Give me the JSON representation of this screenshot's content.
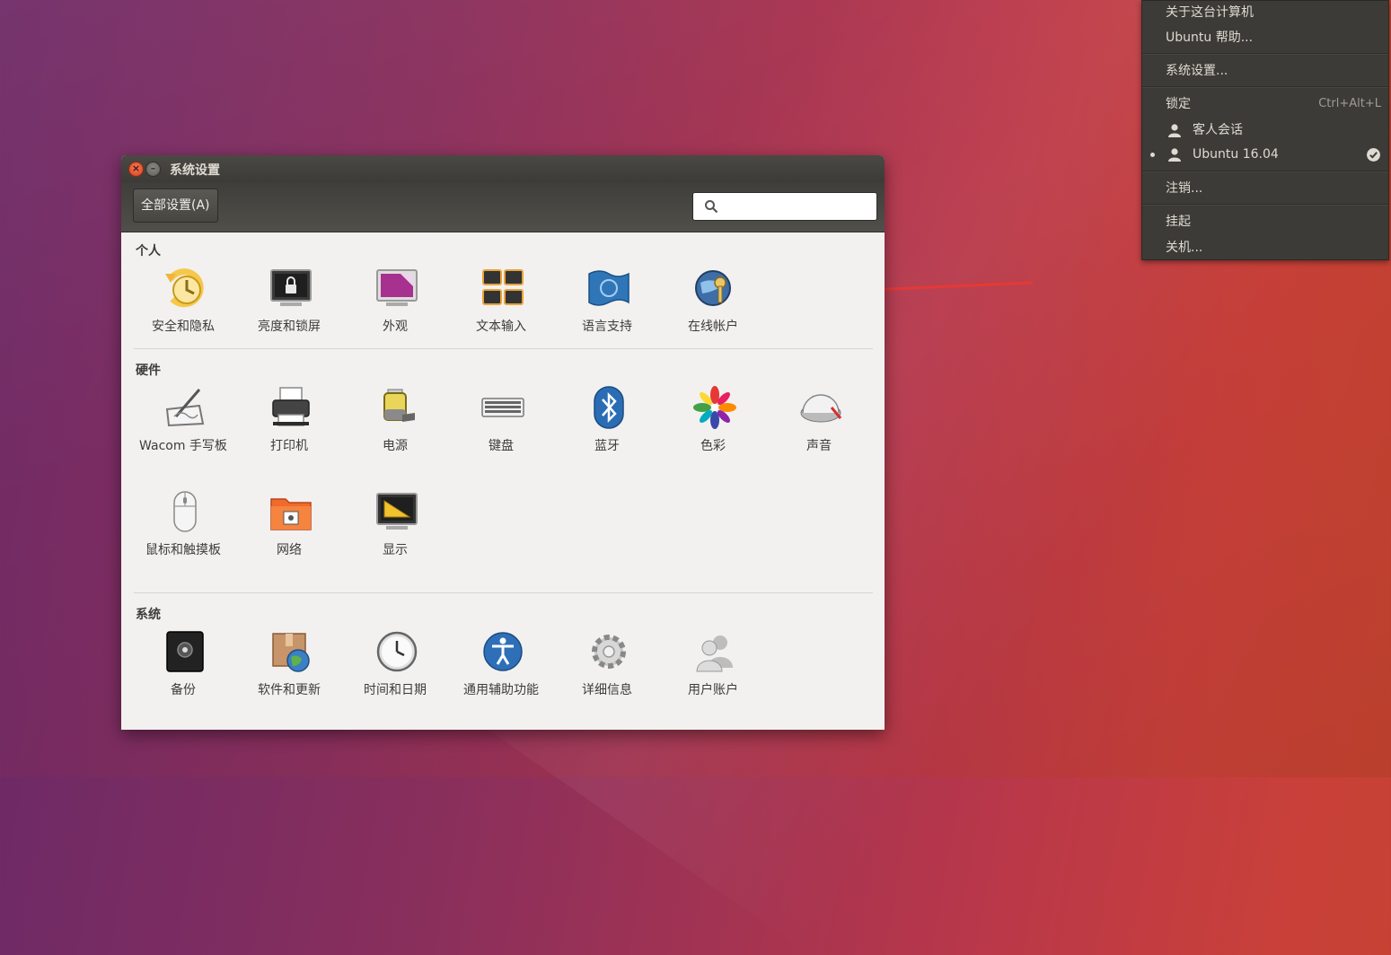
{
  "session_menu": {
    "items": {
      "about": "关于这台计算机",
      "help": "Ubuntu 帮助...",
      "settings": "系统设置...",
      "lock": "锁定",
      "lock_shortcut": "Ctrl+Alt+L",
      "guest": "客人会话",
      "user": "Ubuntu 16.04",
      "logout": "注销...",
      "suspend": "挂起",
      "shutdown": "关机..."
    }
  },
  "window": {
    "title": "系统设置",
    "all_settings": "全部设置(A)",
    "search_placeholder": ""
  },
  "sections": {
    "personal": {
      "title": "个人",
      "items": [
        "安全和隐私",
        "亮度和锁屏",
        "外观",
        "文本输入",
        "语言支持",
        "在线帐户"
      ]
    },
    "hardware": {
      "title": "硬件",
      "items": [
        "Wacom 手写板",
        "打印机",
        "电源",
        "键盘",
        "蓝牙",
        "色彩",
        "声音",
        "鼠标和触摸板",
        "网络",
        "显示"
      ]
    },
    "system": {
      "title": "系统",
      "items": [
        "备份",
        "软件和更新",
        "时间和日期",
        "通用辅助功能",
        "详细信息",
        "用户账户"
      ]
    }
  },
  "colors": {
    "panel": "#3c3b37",
    "accent": "#dd4814",
    "arrow": "#e53935"
  }
}
